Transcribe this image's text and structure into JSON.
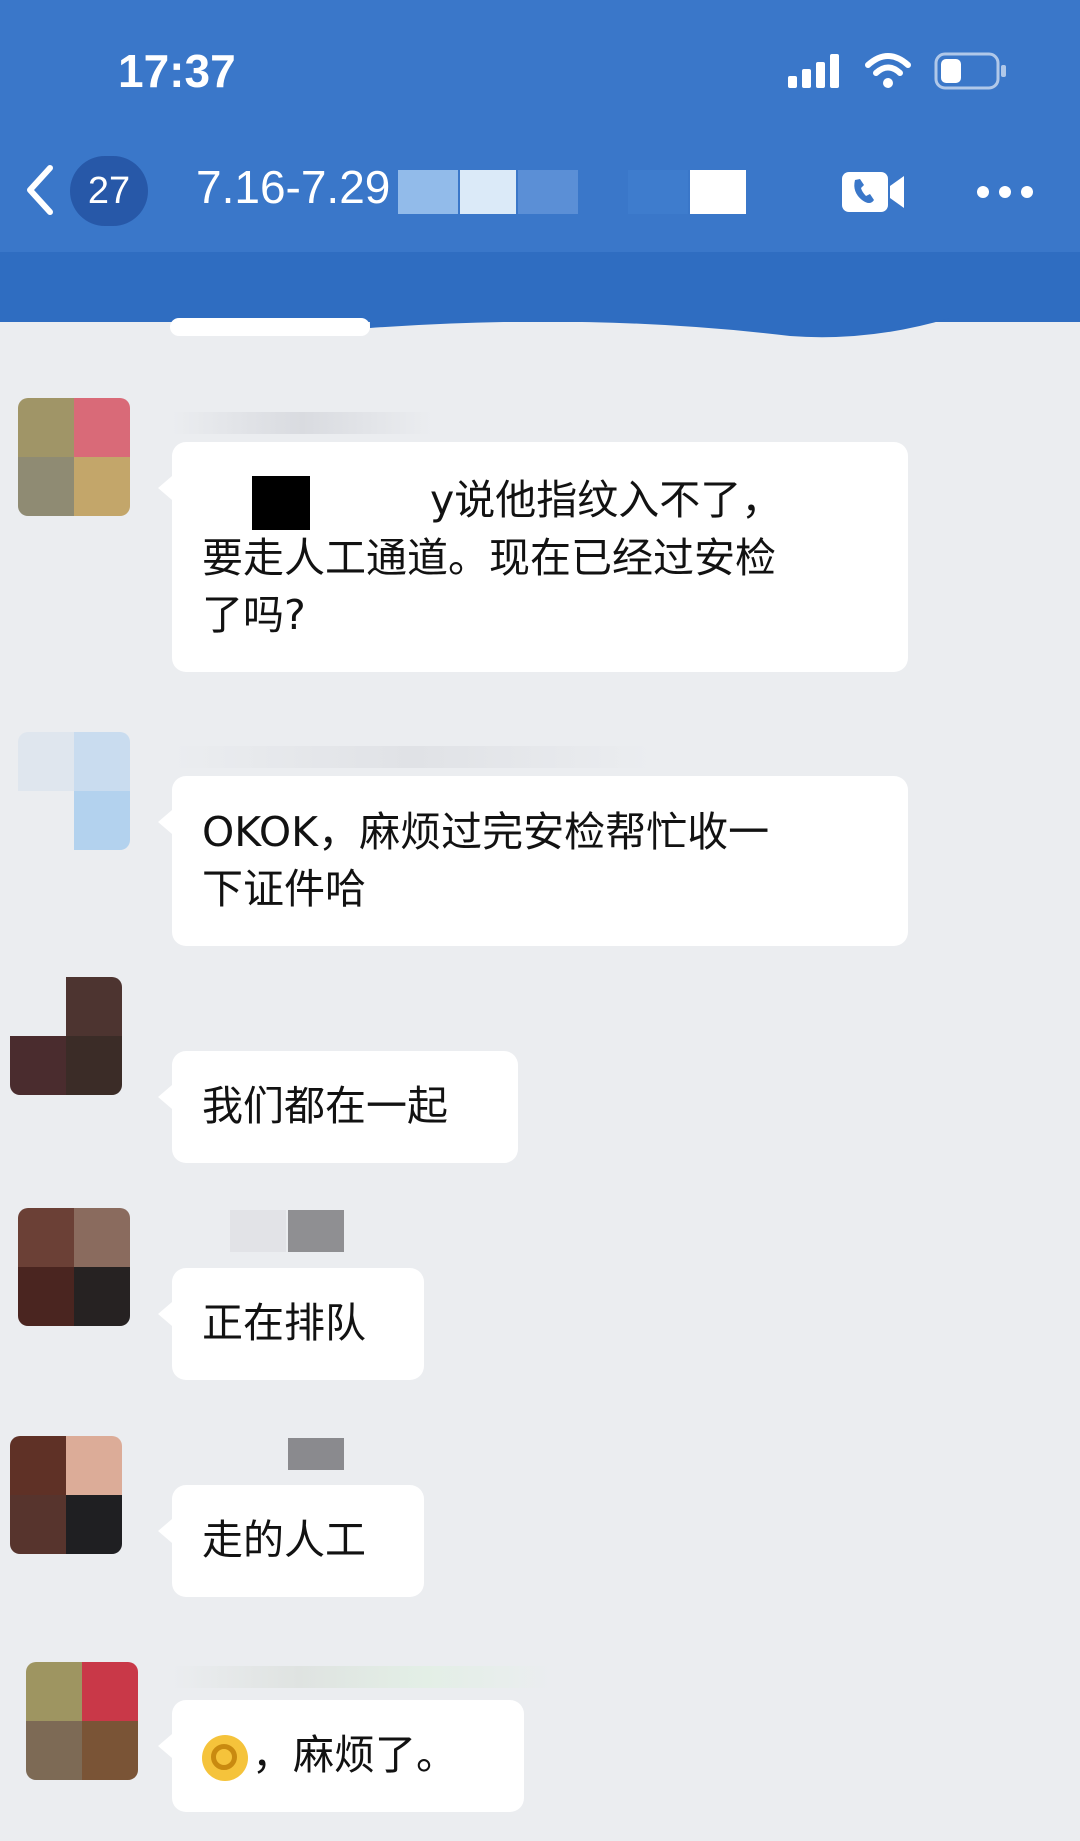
{
  "status_bar": {
    "time": "17:37",
    "icons": [
      "signal-icon",
      "wifi-icon",
      "battery-icon"
    ]
  },
  "header": {
    "back_icon": "chevron-left-icon",
    "unread_count": "27",
    "title": "7.16-7.29",
    "call_icon": "video-call-icon",
    "more_icon": "more-icon"
  },
  "colors": {
    "header_bg": "#3a77c9",
    "chat_bg": "#ebedf0",
    "bubble_bg": "#ffffff",
    "badge_bg": "#2758a8"
  },
  "messages": [
    {
      "lines_text": [
        "y说他指纹入不了，",
        "要走人工通道。现在已经过安检",
        "了吗?"
      ]
    },
    {
      "lines_text": [
        "OKOK，麻烦过完安检帮忙收一",
        "下证件哈"
      ]
    },
    {
      "lines_text": [
        "我们都在一起"
      ]
    },
    {
      "lines_text": [
        "正在排队"
      ]
    },
    {
      "lines_text": [
        "走的人工"
      ]
    },
    {
      "emoji": "ok-hand-emoji",
      "lines_text": [
        "，麻烦了。"
      ]
    }
  ]
}
